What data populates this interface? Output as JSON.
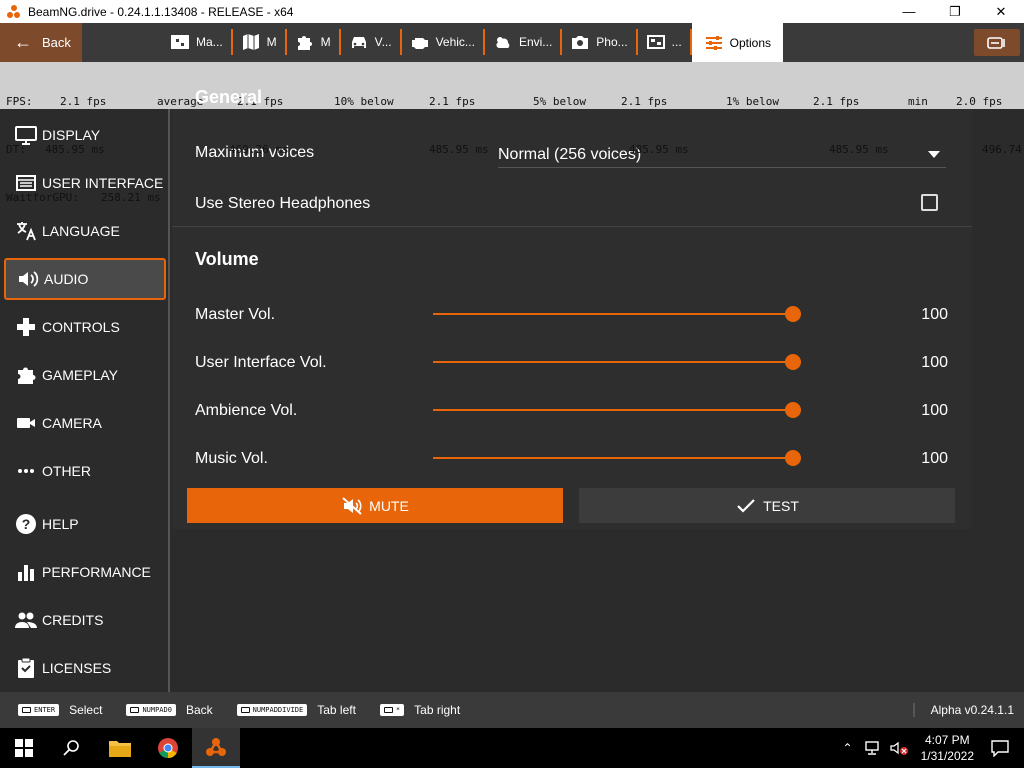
{
  "window": {
    "title": "BeamNG.drive - 0.24.1.1.13408 - RELEASE - x64",
    "minimize_icon": "minimize-icon",
    "maximize_icon": "maximize-icon",
    "close_icon": "close-icon"
  },
  "topbar": {
    "back_label": "Back",
    "tabs": [
      {
        "label": "Ma...",
        "icon": "map-pin-icon"
      },
      {
        "label": "M",
        "icon": "map-icon"
      },
      {
        "label": "M",
        "icon": "puzzle-icon"
      },
      {
        "label": "V...",
        "icon": "car-icon"
      },
      {
        "label": "Vehic...",
        "icon": "engine-icon"
      },
      {
        "label": "Envi...",
        "icon": "weather-icon"
      },
      {
        "label": "Pho...",
        "icon": "camera-icon"
      },
      {
        "label": "...",
        "icon": "replay-icon"
      },
      {
        "label": "Options",
        "icon": "sliders-icon"
      }
    ]
  },
  "debug": {
    "fps_label": "FPS:",
    "fps_value": "2.1 fps",
    "average_label": "average",
    "average_value": "2.1 fps",
    "ten_below_label": "10% below",
    "ten_below_value": "2.1 fps",
    "five_below_label": "5% below",
    "five_below_value": "2.1 fps",
    "one_below_label": "1% below",
    "one_below_value": "2.1 fps",
    "min_label": "min",
    "min_value": "2.0 fps",
    "dt_label": "DT:",
    "dt_value": "485.95 ms",
    "dt_avg": "469.26 ms",
    "dt_ten": "485.95 ms",
    "dt_five": "485.95 ms",
    "dt_one": "485.95 ms",
    "dt_min": "496.74",
    "gpu_label": "WaitforGPU:",
    "gpu_value": "258.21 ms"
  },
  "sidebar": {
    "items": [
      {
        "label": "DISPLAY",
        "icon": "monitor-icon"
      },
      {
        "label": "USER INTERFACE",
        "icon": "window-icon"
      },
      {
        "label": "LANGUAGE",
        "icon": "translate-icon"
      },
      {
        "label": "AUDIO",
        "icon": "speaker-icon",
        "active": true
      },
      {
        "label": "CONTROLS",
        "icon": "gamepad-icon"
      },
      {
        "label": "GAMEPLAY",
        "icon": "puzzle-icon"
      },
      {
        "label": "CAMERA",
        "icon": "videocam-icon"
      },
      {
        "label": "OTHER",
        "icon": "more-icon"
      },
      {
        "label": "HELP",
        "icon": "help-icon"
      },
      {
        "label": "PERFORMANCE",
        "icon": "bar-chart-icon"
      },
      {
        "label": "CREDITS",
        "icon": "people-icon"
      },
      {
        "label": "LICENSES",
        "icon": "clipboard-icon"
      }
    ]
  },
  "general": {
    "header": "General",
    "max_voices_label": "Maximum voices",
    "max_voices_value": "Normal (256 voices)",
    "stereo_label": "Use Stereo Headphones",
    "stereo_checked": false
  },
  "volume": {
    "title": "Volume",
    "sliders": [
      {
        "label": "Master Vol.",
        "value": "100",
        "level": 100
      },
      {
        "label": "User Interface Vol.",
        "value": "100",
        "level": 100
      },
      {
        "label": "Ambience Vol.",
        "value": "100",
        "level": 100
      },
      {
        "label": "Music Vol.",
        "value": "100",
        "level": 100
      }
    ],
    "mute_label": "MUTE",
    "test_label": "TEST"
  },
  "footer": {
    "hints": [
      {
        "key": "ENTER",
        "label": "Select"
      },
      {
        "key": "NUMPAD0",
        "label": "Back"
      },
      {
        "key": "NUMPADDIVIDE",
        "label": "Tab left"
      },
      {
        "key": "*",
        "label": "Tab right"
      }
    ],
    "version": "Alpha v0.24.1.1"
  },
  "taskbar": {
    "time": "4:07 PM",
    "date": "1/31/2022"
  },
  "colors": {
    "accent": "#e8650a",
    "background": "#2b2b2b",
    "panel": "#2e2e2e"
  }
}
